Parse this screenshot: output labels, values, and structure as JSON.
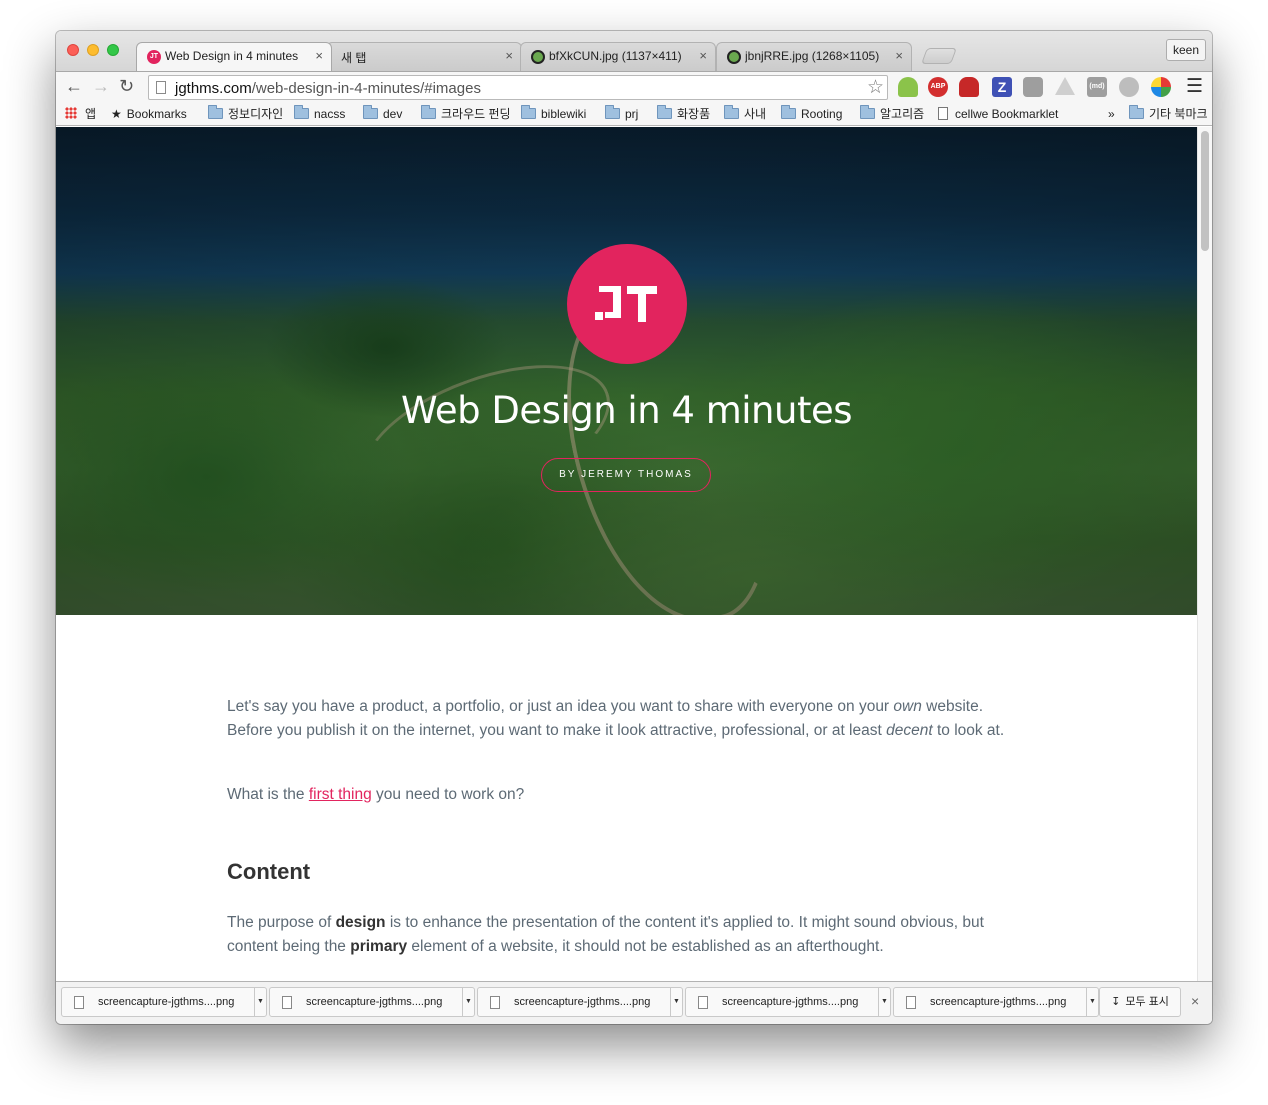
{
  "tabs": [
    {
      "title": "Web Design in 4 minutes",
      "favicon": "JT",
      "favicon_color": "#e2245e"
    },
    {
      "title": "새 탭",
      "favicon": "",
      "favicon_color": ""
    },
    {
      "title": "bfXkCUN.jpg (1137×411)",
      "favicon": "",
      "favicon_color": "#6aa84f"
    },
    {
      "title": "jbnjRRE.jpg (1268×1105)",
      "favicon": "",
      "favicon_color": "#6aa84f"
    }
  ],
  "profile_name": "keen",
  "address": {
    "host": "jgthms.com",
    "path": "/web-design-in-4-minutes/#images"
  },
  "extensions": [
    "android-icon",
    "abp-icon",
    "sofa-icon",
    "z-icon",
    "camera-icon",
    "drive-icon",
    "md-icon",
    "face-icon",
    "pinwheel-icon"
  ],
  "bookmarks": [
    {
      "label": "앱",
      "type": "apps"
    },
    {
      "label": "Bookmarks",
      "type": "star"
    },
    {
      "label": "정보디자인",
      "type": "folder"
    },
    {
      "label": "nacss",
      "type": "folder"
    },
    {
      "label": "dev",
      "type": "folder"
    },
    {
      "label": "크라우드 펀딩",
      "type": "folder"
    },
    {
      "label": "biblewiki",
      "type": "folder"
    },
    {
      "label": "prj",
      "type": "folder"
    },
    {
      "label": "화장품",
      "type": "folder"
    },
    {
      "label": "사내",
      "type": "folder"
    },
    {
      "label": "Rooting",
      "type": "folder"
    },
    {
      "label": "알고리즘",
      "type": "folder"
    },
    {
      "label": "cellwe Bookmarklet",
      "type": "page"
    }
  ],
  "bookmarks_overflow": "»",
  "other_bookmarks": "기타 북마크",
  "hero": {
    "logo_text": "JT",
    "title": "Web Design in 4 minutes",
    "byline": "BY JEREMY THOMAS",
    "accent": "#e2245e"
  },
  "article": {
    "p1_a": "Let's say you have a product, a portfolio, or just an idea you want to share with everyone on your ",
    "p1_em1": "own",
    "p1_b": " website. Before you publish it on the internet, you want to make it look attractive, professional, or at least ",
    "p1_em2": "decent",
    "p1_c": " to look at.",
    "p2_a": "What is the ",
    "p2_link": "first thing",
    "p2_b": " you need to work on?",
    "heading": "Content",
    "p3_a": "The purpose of ",
    "p3_strong1": "design",
    "p3_b": " is to enhance the presentation of the content it's applied to. It might sound obvious, but content being the ",
    "p3_strong2": "primary",
    "p3_c": " element of a website, it should not be established as an afterthought."
  },
  "downloads": [
    {
      "name": "screencapture-jgthms....png"
    },
    {
      "name": "screencapture-jgthms....png"
    },
    {
      "name": "screencapture-jgthms....png"
    },
    {
      "name": "screencapture-jgthms....png"
    },
    {
      "name": "screencapture-jgthms....png"
    }
  ],
  "show_all": "모두 표시"
}
